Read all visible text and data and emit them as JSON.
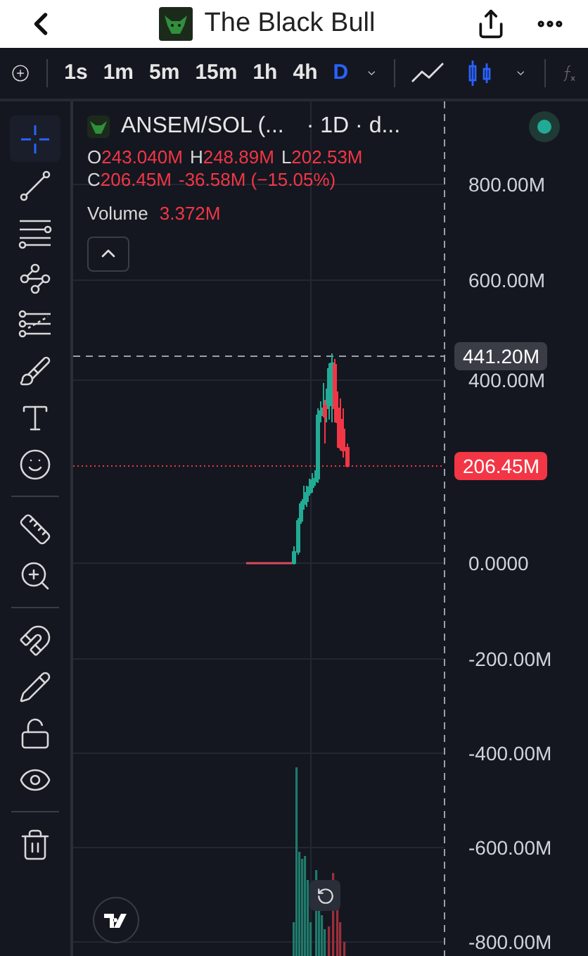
{
  "header": {
    "title": "The Black Bull"
  },
  "toolbar": {
    "timeframes": [
      {
        "label": "1s",
        "selected": false
      },
      {
        "label": "1m",
        "selected": false
      },
      {
        "label": "5m",
        "selected": false
      },
      {
        "label": "15m",
        "selected": false
      },
      {
        "label": "1h",
        "selected": false
      },
      {
        "label": "4h",
        "selected": false
      },
      {
        "label": "D",
        "selected": true
      }
    ],
    "chart_types": [
      {
        "kind": "line",
        "selected": false
      },
      {
        "kind": "candles",
        "selected": true
      }
    ]
  },
  "tool_groups": [
    [
      {
        "kind": "crosshair",
        "selected": true
      },
      {
        "kind": "trend-line",
        "selected": false
      },
      {
        "kind": "horizontal-lines",
        "selected": false
      },
      {
        "kind": "pattern",
        "selected": false
      },
      {
        "kind": "fib",
        "selected": false
      },
      {
        "kind": "brush",
        "selected": false
      },
      {
        "kind": "text",
        "selected": false
      },
      {
        "kind": "emoji",
        "selected": false
      }
    ],
    [
      {
        "kind": "ruler",
        "selected": false
      },
      {
        "kind": "zoom",
        "selected": false
      }
    ],
    [
      {
        "kind": "magnet",
        "selected": false
      },
      {
        "kind": "draw-lock",
        "selected": false
      },
      {
        "kind": "lock",
        "selected": false
      },
      {
        "kind": "eye",
        "selected": false
      }
    ],
    [
      {
        "kind": "trash",
        "selected": false
      }
    ]
  ],
  "legend": {
    "symbol": "ANSEM/SOL (...",
    "interval": "· 1D · d...",
    "live": true,
    "ohlc": [
      {
        "label": "O",
        "value": "243.040M"
      },
      {
        "label": "H",
        "value": "248.89M"
      },
      {
        "label": "L",
        "value": "202.53M"
      },
      {
        "label": "C",
        "value": "206.45M"
      }
    ],
    "change": "-36.58M (−15.05%)",
    "volume_label": "Volume",
    "volume_value": "3.372M"
  },
  "price_axis": [
    "800.00M",
    "600.00M",
    "400.00M",
    "0.0000",
    "-200.00M",
    "-400.00M",
    "-600.00M",
    "-800.00M"
  ],
  "price_tags": [
    {
      "kind": "high",
      "text": "441.20M"
    },
    {
      "kind": "last",
      "text": "206.45M"
    }
  ]
}
